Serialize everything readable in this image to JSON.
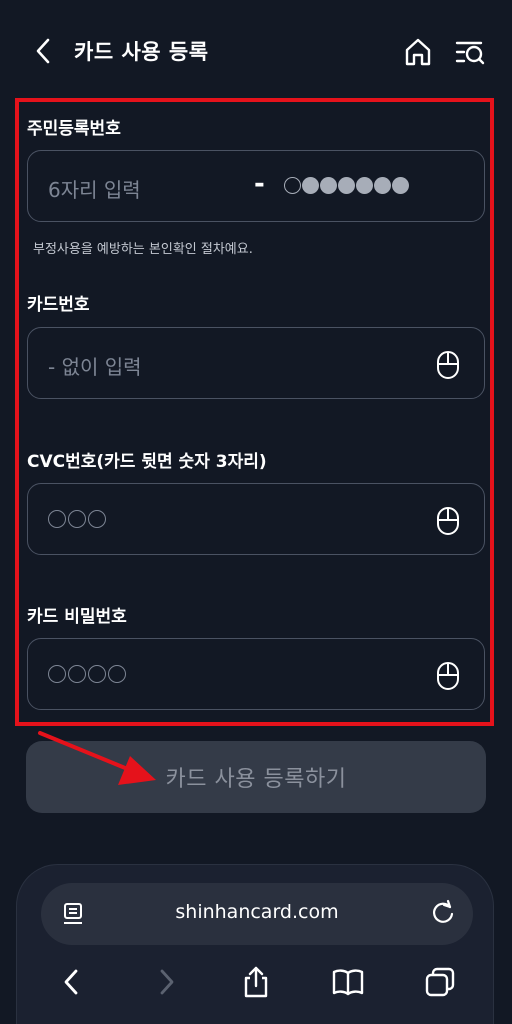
{
  "header": {
    "title": "카드 사용 등록",
    "back_icon": "chevron-left-icon",
    "home_icon": "home-icon",
    "menu_icon": "menu-search-icon"
  },
  "form": {
    "rrn": {
      "label": "주민등록번호",
      "placeholder": "6자리 입력",
      "dash": "-",
      "helper": "부정사용을 예방하는 본인확인 절차예요."
    },
    "card_number": {
      "label": "카드번호",
      "placeholder": "- 없이 입력"
    },
    "cvc": {
      "label": "CVC번호(카드 뒷면 숫자 3자리)"
    },
    "card_password": {
      "label": "카드 비밀번호"
    }
  },
  "submit": {
    "label": "카드 사용 등록하기"
  },
  "browser": {
    "url": "shinhancard.com"
  },
  "colors": {
    "background": "#121824",
    "highlight": "#e5121b",
    "button_disabled": "#343b48"
  }
}
